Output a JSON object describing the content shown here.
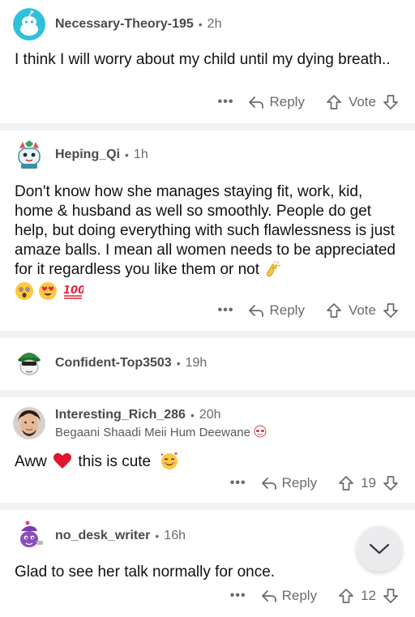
{
  "comments": [
    {
      "username": "Necessary-Theory-195",
      "time": "2h",
      "body": "I think I will worry about my child until my dying breath..",
      "reply_label": "Reply",
      "vote_label": "Vote",
      "more": "•••"
    },
    {
      "username": "Heping_Qi",
      "time": "1h",
      "body": "Don't know how she manages staying fit, work, kid, home & husband as well so smoothly. People do get help, but doing everything with such flawlessness is just amaze balls. I mean all women needs to be appreciated for it regardless you like them or not",
      "reply_label": "Reply",
      "vote_label": "Vote",
      "more": "•••"
    },
    {
      "username": "Confident-Top3503",
      "time": "19h"
    },
    {
      "username": "Interesting_Rich_286",
      "time": "20h",
      "flair": "Begaani Shaadi Meii Hum Deewane",
      "body_pre": "Aww",
      "body_post": "this is cute",
      "reply_label": "Reply",
      "vote_count": "19",
      "more": "•••"
    },
    {
      "username": "no_desk_writer",
      "time": "16h",
      "body": "Glad to see her talk normally for once.",
      "reply_label": "Reply",
      "vote_count": "12",
      "more": "•••"
    }
  ],
  "dot": "•",
  "icons": {
    "reply": "reply-arrow-icon",
    "upvote": "upvote-arrow-icon",
    "downvote": "downvote-arrow-icon",
    "scroll": "chevron-down-icon"
  },
  "colors": {
    "separator": "#f2f2f4",
    "meta": "#6b6b6e"
  }
}
